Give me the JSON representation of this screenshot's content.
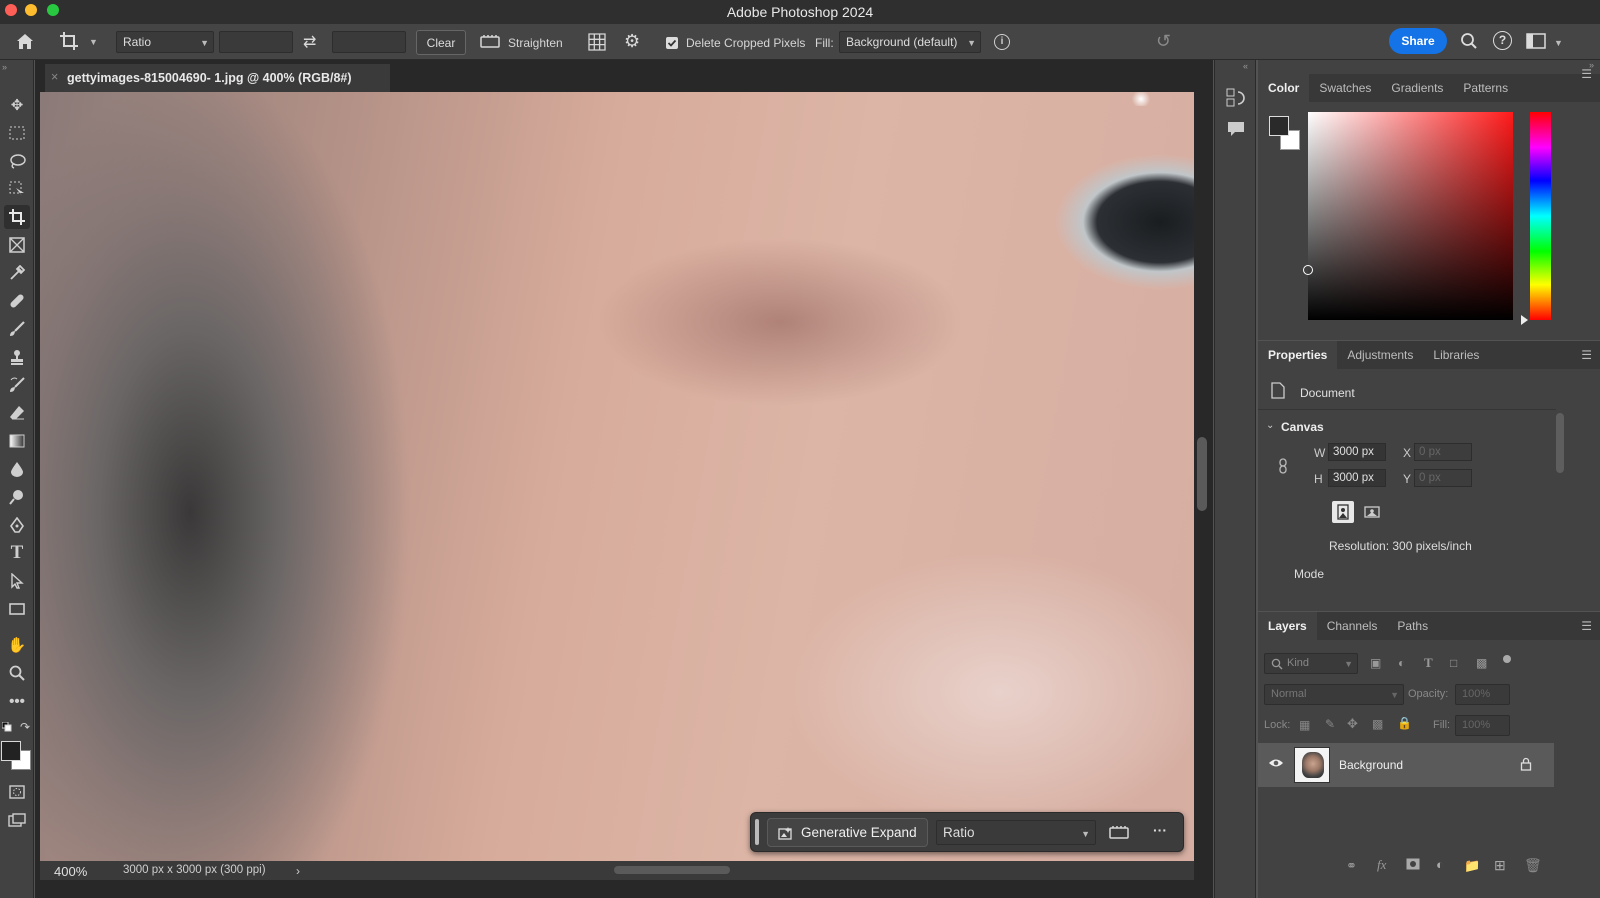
{
  "window": {
    "title": "Adobe Photoshop 2024"
  },
  "options_bar": {
    "ratio_select": "Ratio",
    "clear_label": "Clear",
    "straighten_label": "Straighten",
    "delete_cropped_label": "Delete Cropped Pixels",
    "delete_cropped_checked": true,
    "fill_label": "Fill:",
    "fill_value": "Background (default)",
    "share_label": "Share"
  },
  "document": {
    "tab_title": "gettyimages-815004690- 1.jpg @ 400% (RGB/8#)",
    "zoom": "400%",
    "info": "3000 px x 3000 px (300 ppi)"
  },
  "context_bar": {
    "generative_expand_label": "Generative Expand",
    "ratio_value": "Ratio"
  },
  "color_panel": {
    "tabs": [
      "Color",
      "Swatches",
      "Gradients",
      "Patterns"
    ],
    "hue": "#ff1a1a"
  },
  "properties_panel": {
    "tabs": [
      "Properties",
      "Adjustments",
      "Libraries"
    ],
    "document_label": "Document",
    "canvas_label": "Canvas",
    "w_label": "W",
    "w_value": "3000 px",
    "h_label": "H",
    "h_value": "3000 px",
    "x_label": "X",
    "x_value": "0 px",
    "y_label": "Y",
    "y_value": "0 px",
    "resolution": "Resolution: 300 pixels/inch",
    "mode_label": "Mode"
  },
  "layers_panel": {
    "tabs": [
      "Layers",
      "Channels",
      "Paths"
    ],
    "kind_placeholder": "Kind",
    "blend_mode": "Normal",
    "opacity_label": "Opacity:",
    "opacity_value": "100%",
    "lock_label": "Lock:",
    "fill_label": "Fill:",
    "fill_value": "100%",
    "layers": [
      {
        "name": "Background",
        "visible": true,
        "locked": true
      }
    ]
  }
}
